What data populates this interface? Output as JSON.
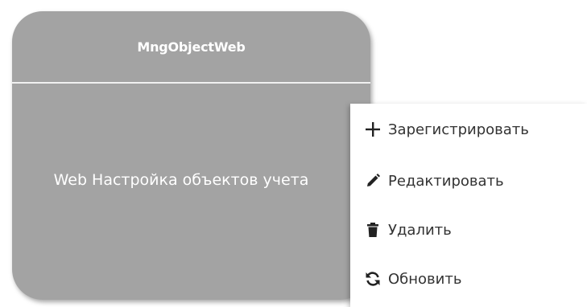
{
  "card": {
    "title": "MngObjectWeb",
    "description": "Web Настройка объектов учета"
  },
  "context_menu": {
    "items": [
      {
        "label": "Зарегистрировать",
        "icon": "plus-icon"
      },
      {
        "label": "Редактировать",
        "icon": "pencil-icon"
      },
      {
        "label": "Удалить",
        "icon": "trash-icon"
      },
      {
        "label": "Обновить",
        "icon": "refresh-icon"
      }
    ]
  },
  "colors": {
    "card_background": "#a3a3a3",
    "card_text": "#ffffff",
    "menu_background": "#ffffff",
    "menu_text": "#333333",
    "icon": "#222222"
  }
}
